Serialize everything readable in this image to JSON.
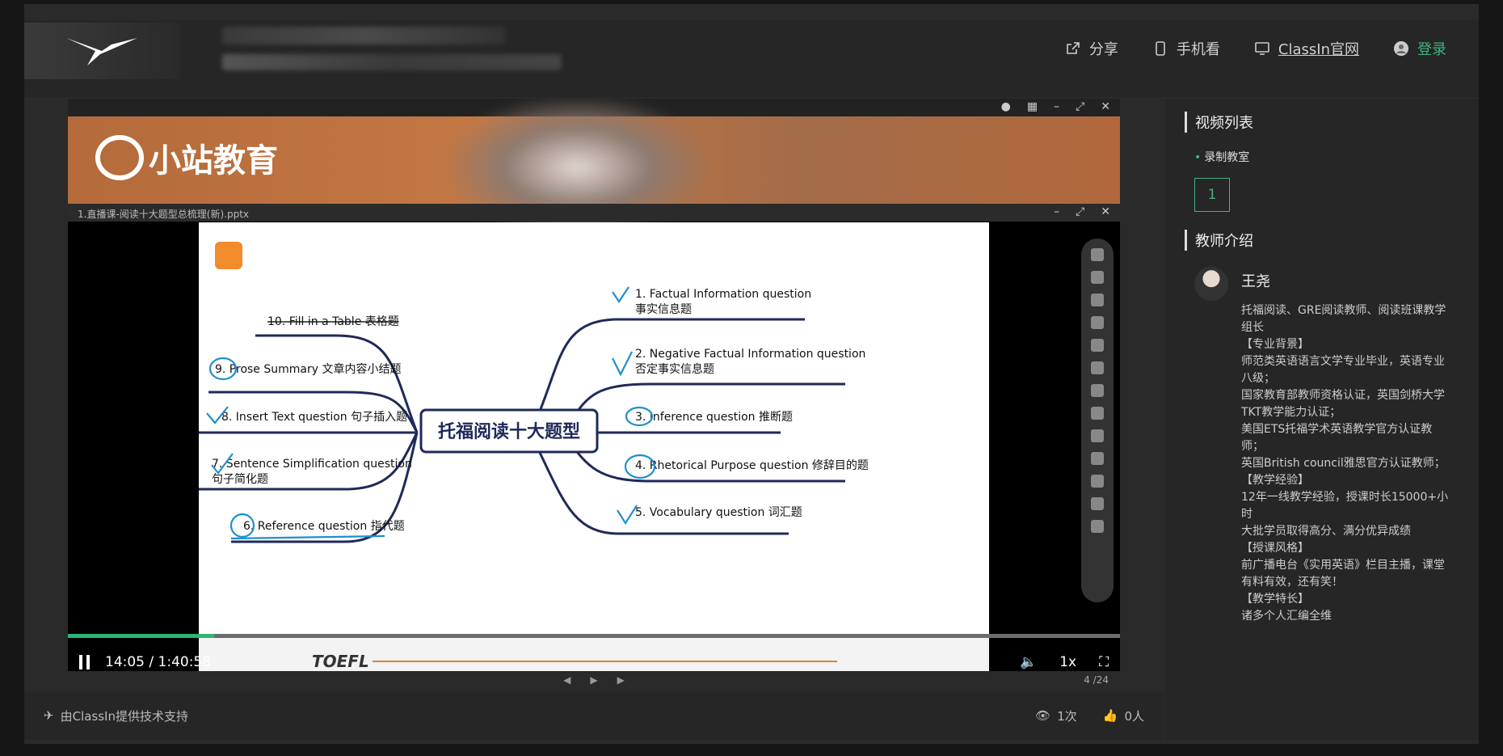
{
  "header": {
    "share": "分享",
    "mobile": "手机看",
    "official_site": "ClassIn官网",
    "login": "登录"
  },
  "player": {
    "banner_text": "小站教育",
    "file_name": "1.直播课-阅读十大题型总梳理(新).pptx",
    "time_current": "14:05",
    "time_total": "1:40:58",
    "speed": "1x",
    "page": "4 /24",
    "progress_fraction": 0.139,
    "mindmap": {
      "center": "托福阅读十大题型",
      "right": [
        {
          "title": "1. Factual Information question",
          "sub": "事实信息题"
        },
        {
          "title": "2. Negative Factual Information question",
          "sub": "否定事实信息题"
        },
        {
          "title": "3. Inference question 推断题",
          "sub": ""
        },
        {
          "title": "4. Rhetorical Purpose question 修辞目的题",
          "sub": ""
        },
        {
          "title": "5. Vocabulary question 词汇题",
          "sub": ""
        }
      ],
      "left": [
        {
          "title": "10. Fill in a Table 表格题",
          "sub": ""
        },
        {
          "title": "9. Prose Summary 文章内容小结题",
          "sub": ""
        },
        {
          "title": "8. Insert Text question 句子插入题",
          "sub": ""
        },
        {
          "title": "7. Sentence Simplification question",
          "sub": "句子简化题"
        },
        {
          "title": "6. Reference question 指代题",
          "sub": ""
        }
      ],
      "footer_brand": "TOEFL"
    }
  },
  "footer": {
    "powered_by": "由ClassIn提供技术支持",
    "views": "1次",
    "likes": "0人"
  },
  "sidebar": {
    "video_list_title": "视频列表",
    "room_name": "录制教室",
    "video_item": "1",
    "teacher_title": "教师介绍",
    "teacher_name": "王尧",
    "bio": [
      "托福阅读、GRE阅读教师、阅读班课教学组长",
      "【专业背景】",
      "师范类英语语言文学专业毕业，英语专业八级；",
      "国家教育部教师资格认证，英国剑桥大学TKT教学能力认证；",
      "美国ETS托福学术英语教学官方认证教师；",
      "英国British council雅思官方认证教师；",
      "【教学经验】",
      "12年一线教学经验，授课时长15000+小时",
      "大批学员取得高分、满分优异成绩",
      "【授课风格】",
      "前广播电台《实用英语》栏目主播，课堂有料有效，还有笑！",
      "【教学特长】",
      "诸多个人汇编全维"
    ]
  }
}
